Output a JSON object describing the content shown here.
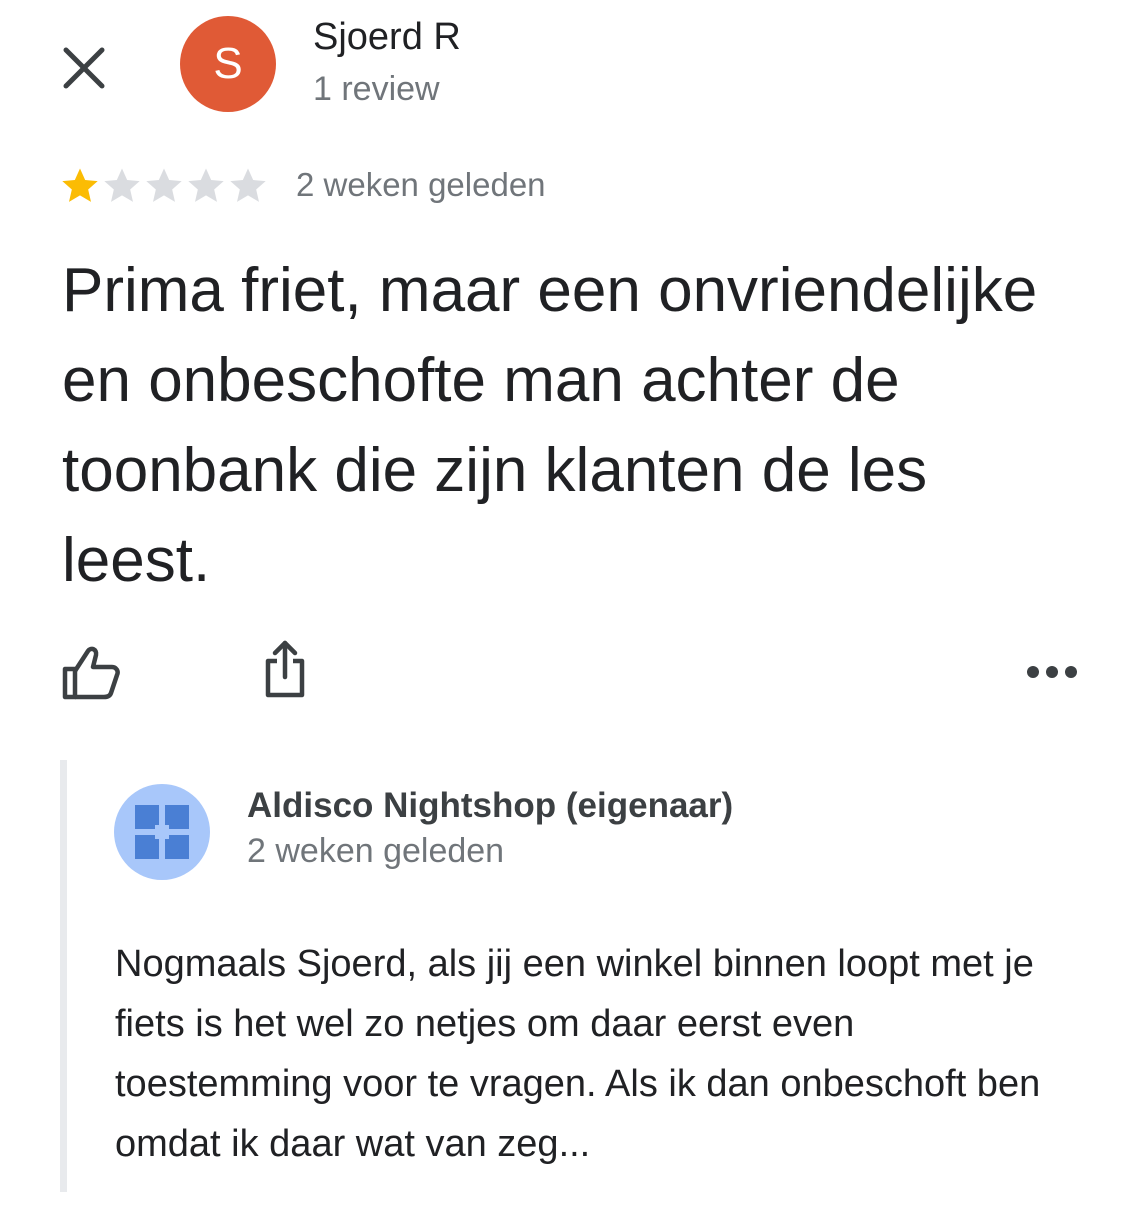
{
  "reviewer": {
    "name": "Sjoerd R",
    "avatar_initial": "S",
    "avatar_color": "#e05a36",
    "review_count": "1 review"
  },
  "review": {
    "rating": 1,
    "max_rating": 5,
    "star_filled_color": "#fbbc04",
    "star_empty_color": "#dadce0",
    "date": "2 weken geleden",
    "text": "Prima friet, maar een onvriendelijke en onbeschofte man achter de toonbank die zijn klanten de les leest."
  },
  "actions": {
    "close_icon": "close-icon",
    "like_icon": "thumbs-up-icon",
    "share_icon": "share-icon",
    "more_icon": "more-horizontal-icon"
  },
  "owner_reply": {
    "name": "Aldisco Nightshop (eigenaar)",
    "date": "2 weken geleden",
    "avatar_bg": "#a8c7fa",
    "avatar_fg": "#4a7fd4",
    "text": "Nogmaals Sjoerd, als jij een winkel binnen loopt met je fiets is het wel zo netjes om daar eerst even toestemming voor te vragen. Als ik dan onbeschoft ben omdat ik daar wat van zeg..."
  }
}
